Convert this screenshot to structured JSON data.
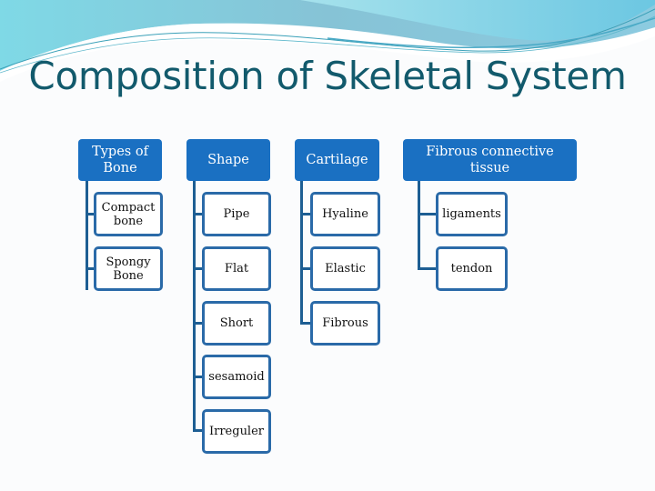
{
  "title": "Composition of Skeletal System",
  "colors": {
    "header_fill": "#1a70c2",
    "connector": "#1d5e93",
    "child_border": "#2a6aa8",
    "title_text": "#125a6c"
  },
  "columns": [
    {
      "header": "Types of Bone",
      "children": [
        "Compact bone",
        "Spongy Bone"
      ]
    },
    {
      "header": "Shape",
      "children": [
        "Pipe",
        "Flat",
        "Short",
        "sesamoid",
        "Irreguler"
      ]
    },
    {
      "header": "Cartilage",
      "children": [
        "Hyaline",
        "Elastic",
        "Fibrous"
      ]
    },
    {
      "header": "Fibrous connective tissue",
      "children": [
        "ligaments",
        "tendon"
      ]
    }
  ]
}
